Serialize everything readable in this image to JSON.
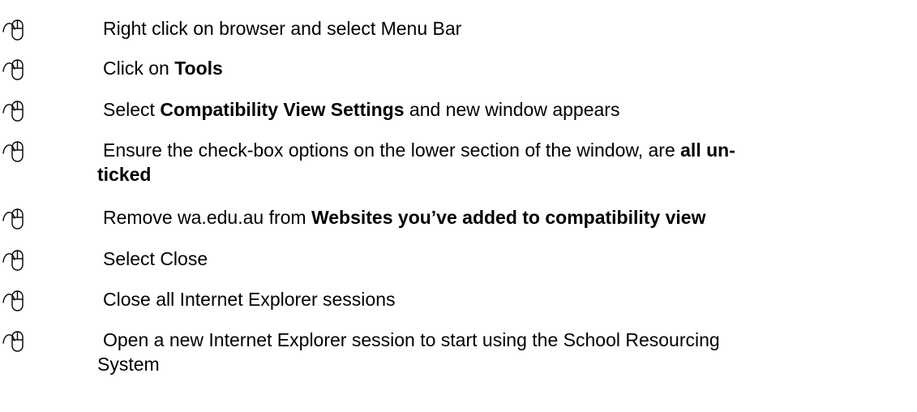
{
  "icon": "mouse-pointer-icon",
  "steps": [
    {
      "parts": [
        {
          "text": "Right click on browser and select Menu Bar",
          "bold": false
        }
      ]
    },
    {
      "parts": [
        {
          "text": "Click on ",
          "bold": false
        },
        {
          "text": "Tools",
          "bold": true
        }
      ]
    },
    {
      "parts": [
        {
          "text": "Select  ",
          "bold": false
        },
        {
          "text": "Compatibility View Settings",
          "bold": true
        },
        {
          "text": " and new window appears",
          "bold": false
        }
      ]
    },
    {
      "parts": [
        {
          "text": "Ensure the check-box options on the lower section of the window, are ",
          "bold": false
        },
        {
          "text": "all un-",
          "bold": true
        }
      ],
      "line2": [
        {
          "text": "ticked",
          "bold": true
        }
      ]
    },
    {
      "parts": [
        {
          "text": "Remove wa.edu.au from ",
          "bold": false
        },
        {
          "text": "Websites you’ve added to compatibility view",
          "bold": true
        }
      ]
    },
    {
      "parts": [
        {
          "text": "Select Close",
          "bold": false
        }
      ]
    },
    {
      "parts": [
        {
          "text": "Close all Internet Explorer sessions",
          "bold": false
        }
      ]
    },
    {
      "parts": [
        {
          "text": "Open a new Internet Explorer session to start using the School Resourcing",
          "bold": false
        }
      ],
      "line2": [
        {
          "text": "System",
          "bold": false
        }
      ]
    }
  ]
}
